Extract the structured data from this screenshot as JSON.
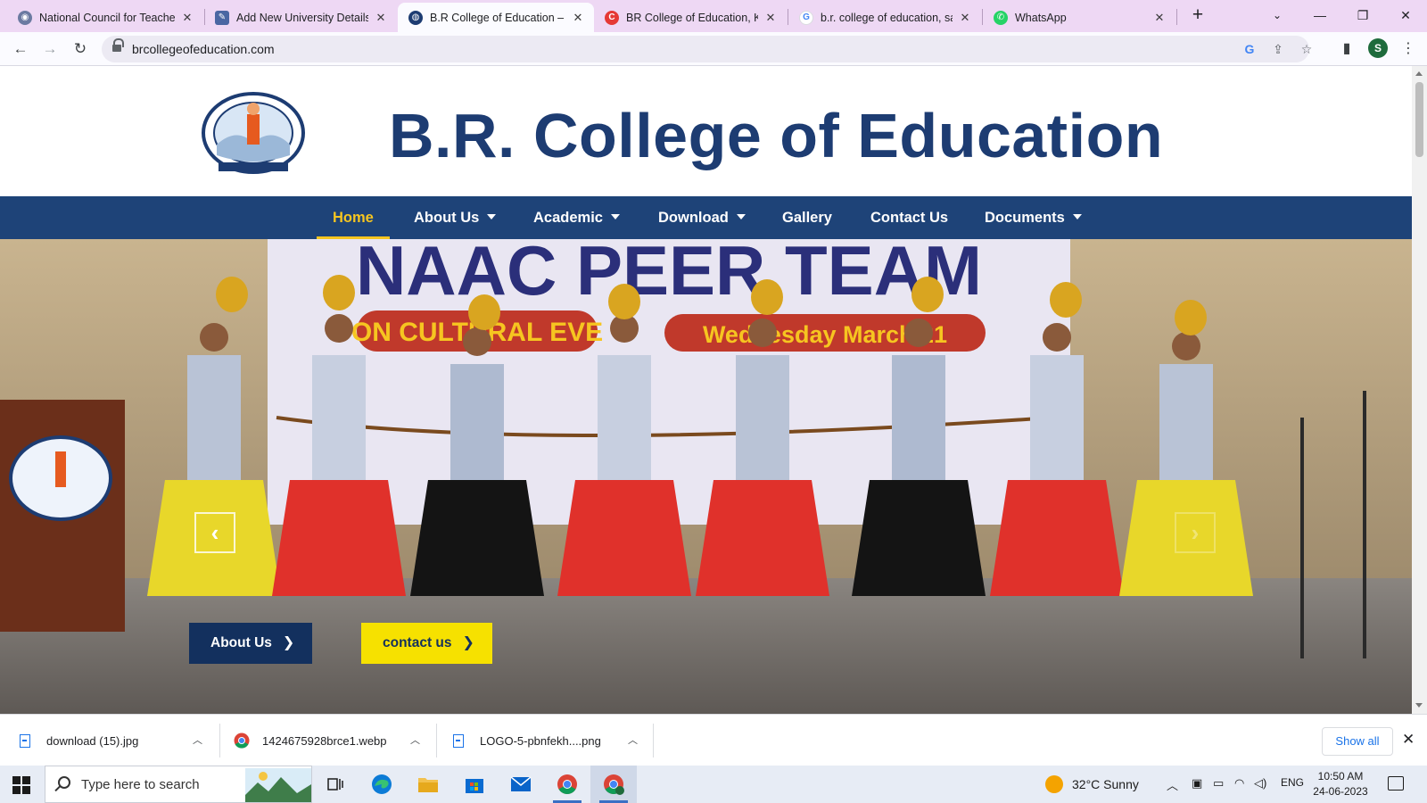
{
  "browser": {
    "tabs": [
      {
        "title": "National Council for Teacher",
        "favicon": "ncte-icon",
        "color": "#6b7aa1"
      },
      {
        "title": "Add New University Details",
        "favicon": "form-icon",
        "color": "#4a67a3"
      },
      {
        "title": "B.R College of Education – K",
        "favicon": "college-logo-icon",
        "color": "#1d3c72",
        "active": true
      },
      {
        "title": "BR College of Education, Ku",
        "favicon": "red-c-icon",
        "color": "#e53935"
      },
      {
        "title": "b.r. college of education, sa",
        "favicon": "google-icon",
        "color": "#4285f4"
      },
      {
        "title": "WhatsApp",
        "favicon": "whatsapp-icon",
        "color": "#25d366"
      }
    ],
    "url": "brcollegeofeducation.com",
    "profile_initial": "S"
  },
  "site": {
    "title": "B.R. College of Education",
    "logo_text_top": "B.R. COLLEGE OF EDUCATION",
    "logo_text_bottom": "ENLIGHTEN THE UNIVERSE",
    "menu": [
      {
        "label": "Home",
        "active": true,
        "dropdown": false
      },
      {
        "label": "About Us",
        "dropdown": true
      },
      {
        "label": "Academic",
        "dropdown": true
      },
      {
        "label": "Download",
        "dropdown": true
      },
      {
        "label": "Gallery",
        "dropdown": false
      },
      {
        "label": "Contact Us",
        "dropdown": false
      },
      {
        "label": "Documents",
        "dropdown": true
      }
    ],
    "hero": {
      "banner_line1": "NAAC PEER TEAM",
      "banner_line2": "ON CULTURAL EVE",
      "banner_date": "Wednesday March 21",
      "buttons": [
        {
          "label": "About Us"
        },
        {
          "label": "contact us"
        }
      ]
    },
    "colors": {
      "brand_blue": "#1e4378",
      "accent_yellow": "#f6c520",
      "title_blue": "#1d3c72"
    }
  },
  "downloads": {
    "items": [
      {
        "name": "download (15).jpg",
        "icon": "file-icon"
      },
      {
        "name": "1424675928brce1.webp",
        "icon": "chrome-icon"
      },
      {
        "name": "LOGO-5-pbnfekh....png",
        "icon": "file-icon"
      }
    ],
    "show_all": "Show all"
  },
  "taskbar": {
    "search_placeholder": "Type here to search",
    "weather": "32°C  Sunny",
    "lang": "ENG",
    "time": "10:50 AM",
    "date": "24-06-2023"
  }
}
